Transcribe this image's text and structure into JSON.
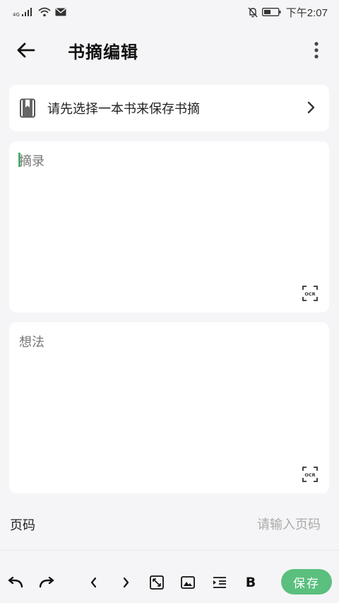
{
  "status_bar": {
    "network": "4G",
    "time": "下午2:07"
  },
  "header": {
    "title": "书摘编辑"
  },
  "book_select": {
    "label": "请先选择一本书来保存书摘"
  },
  "excerpt": {
    "placeholder": "摘录",
    "ocr_label": "OCR"
  },
  "thought": {
    "placeholder": "想法",
    "ocr_label": "OCR"
  },
  "page_number": {
    "label": "页码",
    "placeholder": "请输入页码"
  },
  "toolbar": {
    "bold_label": "B",
    "save_label": "保存"
  },
  "colors": {
    "accent": "#5bbf7e",
    "background": "#f5f5f7",
    "card": "#ffffff"
  }
}
